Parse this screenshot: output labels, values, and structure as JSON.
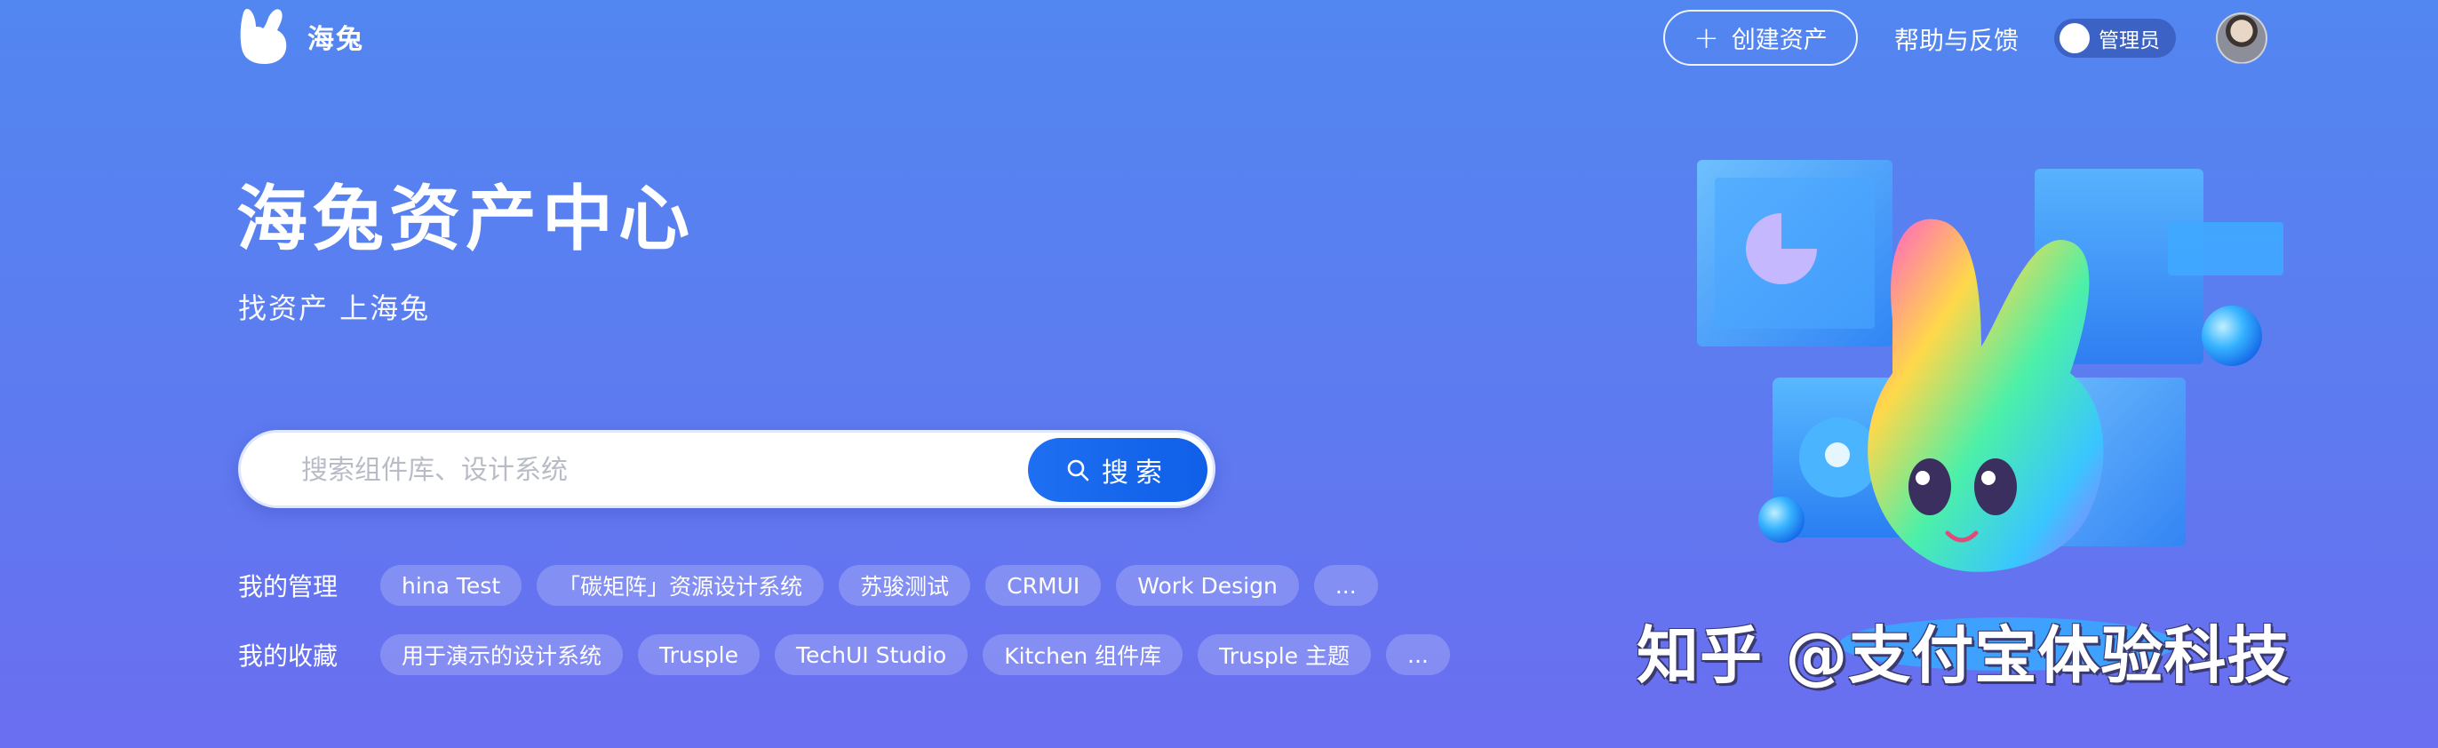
{
  "header": {
    "brand": "海兔",
    "create_button": "创建资产",
    "help_link": "帮助与反馈",
    "admin_toggle_label": "管理员"
  },
  "hero": {
    "title": "海兔资产中心",
    "subtitle": "找资产 上海兔"
  },
  "search": {
    "placeholder": "搜索组件库、设计系统",
    "button_label": "搜索"
  },
  "my_manage": {
    "label": "我的管理",
    "tags": [
      "hina Test",
      "「碳矩阵」资源设计系统",
      "苏骏测试",
      "CRMUI",
      "Work Design",
      "..."
    ]
  },
  "my_favorites": {
    "label": "我的收藏",
    "tags": [
      "用于演示的设计系统",
      "Trusple",
      "TechUI Studio",
      "Kitchen 组件库",
      "Trusple 主题",
      "..."
    ]
  },
  "watermark": "知乎 @支付宝体验科技",
  "colors": {
    "background_top": "#5286f0",
    "background_bottom": "#6a6ef0",
    "search_button": "#1f6ff2"
  }
}
